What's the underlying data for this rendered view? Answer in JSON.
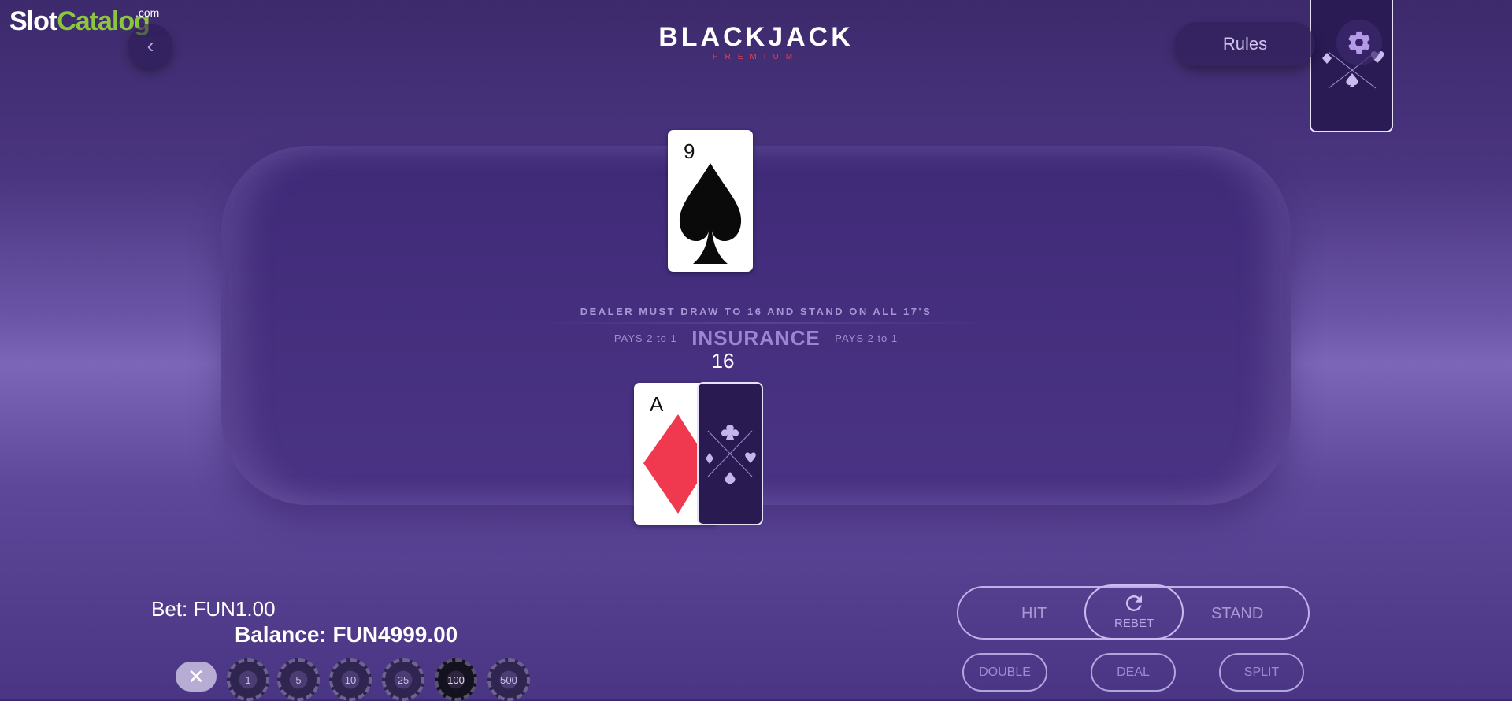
{
  "watermark": {
    "part1": "Slot",
    "part2": "Catalog",
    "suffix": ".com"
  },
  "header": {
    "back_icon": "chevron-left-icon",
    "logo_title": "BLACKJACK",
    "logo_subtitle": "PREMIUM",
    "rules_label": "Rules",
    "settings_icon": "gear-icon"
  },
  "table": {
    "rule_text": "DEALER MUST DRAW TO 16 AND STAND ON ALL 17'S",
    "insurance_label": "INSURANCE",
    "pays_left": "PAYS 2  to 1",
    "pays_right": "PAYS 2  to 1"
  },
  "dealer": {
    "cards": [
      {
        "rank": "9",
        "suit": "spades",
        "face_up": true
      }
    ]
  },
  "player": {
    "total": "16",
    "cards": [
      {
        "rank": "A",
        "suit": "diamonds",
        "face_up": true
      },
      {
        "rank": "",
        "suit": "",
        "face_up": false
      }
    ]
  },
  "wallet": {
    "bet_label": "Bet:",
    "bet_value": "FUN1.00",
    "balance_label": "Balance:",
    "balance_value": "FUN4999.00"
  },
  "chips": {
    "clear_icon": "close-icon",
    "values": [
      "1",
      "5",
      "10",
      "25",
      "100",
      "500"
    ]
  },
  "actions": {
    "hit": "HIT",
    "rebet": "REBET",
    "rebet_icon": "refresh-icon",
    "stand": "STAND",
    "double": "DOUBLE",
    "deal": "DEAL",
    "split": "SPLIT"
  },
  "colors": {
    "accent": "#e0405a",
    "diamond_red": "#f0394f",
    "watermark_green": "#8cc63f"
  }
}
